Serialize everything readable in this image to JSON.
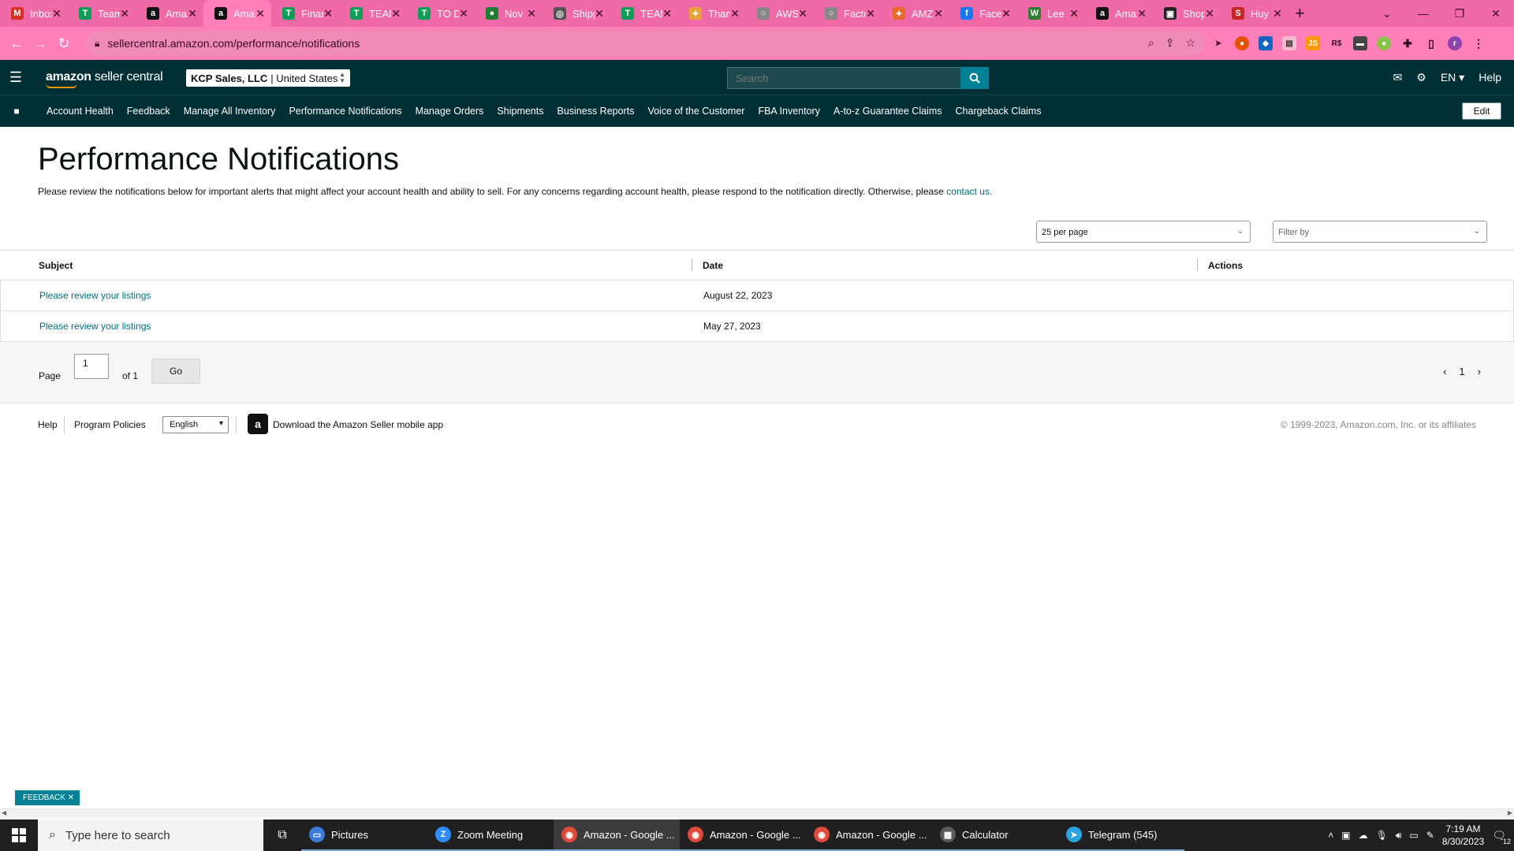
{
  "browser": {
    "tabs": [
      {
        "title": "Inbox",
        "color": "#d93025",
        "glyph": "M"
      },
      {
        "title": "Team",
        "color": "#0f9d58",
        "glyph": "T"
      },
      {
        "title": "Amazon",
        "color": "#111111",
        "glyph": "a"
      },
      {
        "title": "Amazon",
        "color": "#111111",
        "glyph": "a",
        "active": true
      },
      {
        "title": "Finance",
        "color": "#0f9d58",
        "glyph": "T"
      },
      {
        "title": "TEAM",
        "color": "#0f9d58",
        "glyph": "T"
      },
      {
        "title": "TO DO",
        "color": "#0f9d58",
        "glyph": "T"
      },
      {
        "title": "Nov",
        "color": "#1e7d32",
        "glyph": "●"
      },
      {
        "title": "Shipping",
        "color": "#555555",
        "glyph": "◎"
      },
      {
        "title": "TEAM",
        "color": "#0f9d58",
        "glyph": "T"
      },
      {
        "title": "Thanks",
        "color": "#e8a23a",
        "glyph": "✦"
      },
      {
        "title": "AWS",
        "color": "#888888",
        "glyph": "○"
      },
      {
        "title": "Factory",
        "color": "#888888",
        "glyph": "○"
      },
      {
        "title": "AMZ",
        "color": "#e86a2a",
        "glyph": "✦"
      },
      {
        "title": "Facebook",
        "color": "#1877f2",
        "glyph": "f"
      },
      {
        "title": "Lee",
        "color": "#2e7d32",
        "glyph": "W"
      },
      {
        "title": "Amazon",
        "color": "#111111",
        "glyph": "a"
      },
      {
        "title": "Shop",
        "color": "#222222",
        "glyph": "▣"
      },
      {
        "title": "Huy",
        "color": "#c62828",
        "glyph": "S"
      }
    ],
    "new_tab": "+",
    "url": "sellercentral.amazon.com/performance/notifications"
  },
  "header": {
    "logo_bold": "amazon",
    "logo_rest": " seller central",
    "account_name": "KCP Sales, LLC",
    "account_region": "| United States",
    "search_placeholder": "Search",
    "language": "EN",
    "help": "Help"
  },
  "nav": {
    "items": [
      "Account Health",
      "Feedback",
      "Manage All Inventory",
      "Performance Notifications",
      "Manage Orders",
      "Shipments",
      "Business Reports",
      "Voice of the Customer",
      "FBA Inventory",
      "A-to-z Guarantee Claims",
      "Chargeback Claims"
    ],
    "edit": "Edit"
  },
  "page": {
    "title": "Performance Notifications",
    "description": "Please review the notifications below for important alerts that might affect your account health and ability to sell. For any concerns regarding account health, please respond to the notification directly. Otherwise, please ",
    "contact_link": "contact us.",
    "per_page": "25 per page",
    "filter_placeholder": "Filter by"
  },
  "table": {
    "columns": [
      "Subject",
      "Date",
      "Actions"
    ],
    "rows": [
      {
        "subject": "Please review your listings",
        "date": "August 22, 2023"
      },
      {
        "subject": "Please review your listings",
        "date": "May 27, 2023"
      }
    ]
  },
  "pager": {
    "page_label": "Page",
    "page_value": "1",
    "of_label": "of 1",
    "go": "Go",
    "current": "1"
  },
  "footer": {
    "help": "Help",
    "policies": "Program Policies",
    "language": "English",
    "app_text": "Download the Amazon Seller mobile app",
    "copyright": "© 1999-2023, Amazon.com, Inc. or its affiliates"
  },
  "feedback": "FEEDBACK",
  "taskbar": {
    "search_placeholder": "Type here to search",
    "apps": [
      {
        "label": "Pictures",
        "color": "#3c7ad8",
        "glyph": "▭",
        "state": "open"
      },
      {
        "label": "Zoom Meeting",
        "color": "#2d8cff",
        "glyph": "Z",
        "state": "open"
      },
      {
        "label": "Amazon - Google ...",
        "color": "#e04a3a",
        "glyph": "◉",
        "state": "active"
      },
      {
        "label": "Amazon - Google ...",
        "color": "#e04a3a",
        "glyph": "◉",
        "state": "open"
      },
      {
        "label": "Amazon - Google ...",
        "color": "#e04a3a",
        "glyph": "◉",
        "state": "open"
      },
      {
        "label": "Calculator",
        "color": "#5a5a5a",
        "glyph": "▦",
        "state": "open"
      },
      {
        "label": "Telegram (545)",
        "color": "#2aa3e0",
        "glyph": "➤",
        "state": "open"
      }
    ],
    "time": "7:19 AM",
    "date": "8/30/2023",
    "notifications": "12"
  }
}
